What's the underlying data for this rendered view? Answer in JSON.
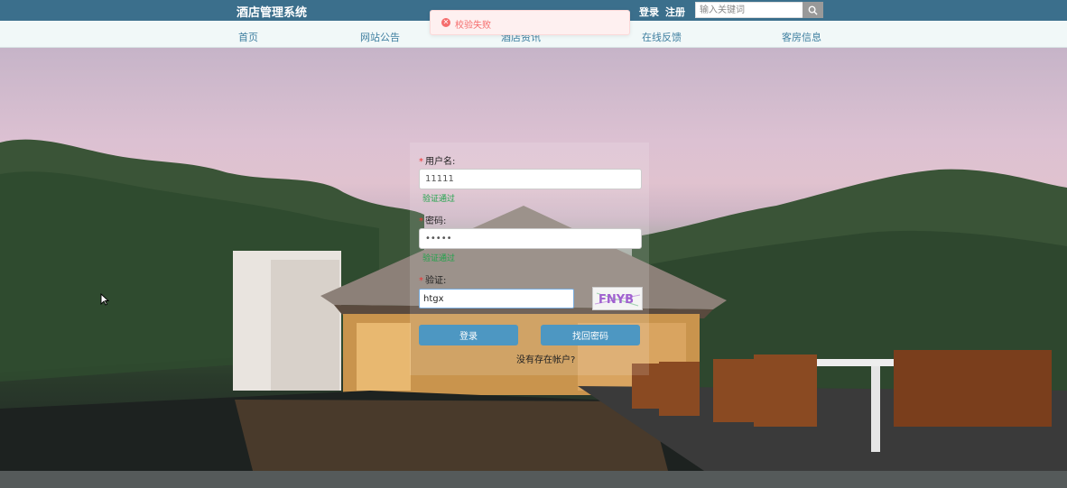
{
  "header": {
    "brand": "酒店管理系统",
    "login_label": "登录",
    "register_label": "注册",
    "search_placeholder": "输入关键词"
  },
  "nav": {
    "items": [
      {
        "label": "首页"
      },
      {
        "label": "网站公告"
      },
      {
        "label": "酒店资讯"
      },
      {
        "label": "在线反馈"
      },
      {
        "label": "客房信息"
      }
    ]
  },
  "toast": {
    "message": "校验失败",
    "type": "error",
    "color": "#f56c6c"
  },
  "login_form": {
    "username_label": "用户名:",
    "username_value": "11111",
    "username_ok": "验证通过",
    "password_label": "密码:",
    "password_value": "•••••",
    "password_ok": "验证通过",
    "captcha_label": "验证:",
    "captcha_value": "htgx",
    "captcha_image_text": "FNYB",
    "login_button": "登录",
    "forgot_button": "找回密码",
    "register_link": "没有存在帐户?"
  },
  "colors": {
    "topbar": "#3b6f8c",
    "nav_bg": "#f1f8f8",
    "nav_text": "#3f7fa0",
    "button": "#4d97c2",
    "success": "#1fa34a"
  }
}
